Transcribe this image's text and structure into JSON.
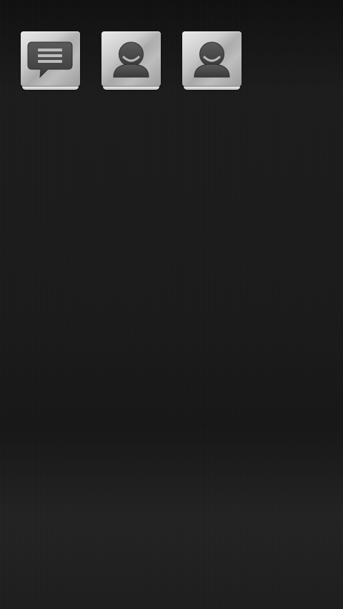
{
  "home_screen": {
    "shortcuts": [
      {
        "icon": "message-icon",
        "label": ""
      },
      {
        "icon": "contact-icon",
        "label": ""
      },
      {
        "icon": "contact-icon",
        "label": ""
      }
    ]
  },
  "colors": {
    "wallpaper": "#1a1a1a",
    "tile_light": "#dcdcdc",
    "tile_dark": "#9d9d9d",
    "glyph": "#4a4a4a"
  }
}
